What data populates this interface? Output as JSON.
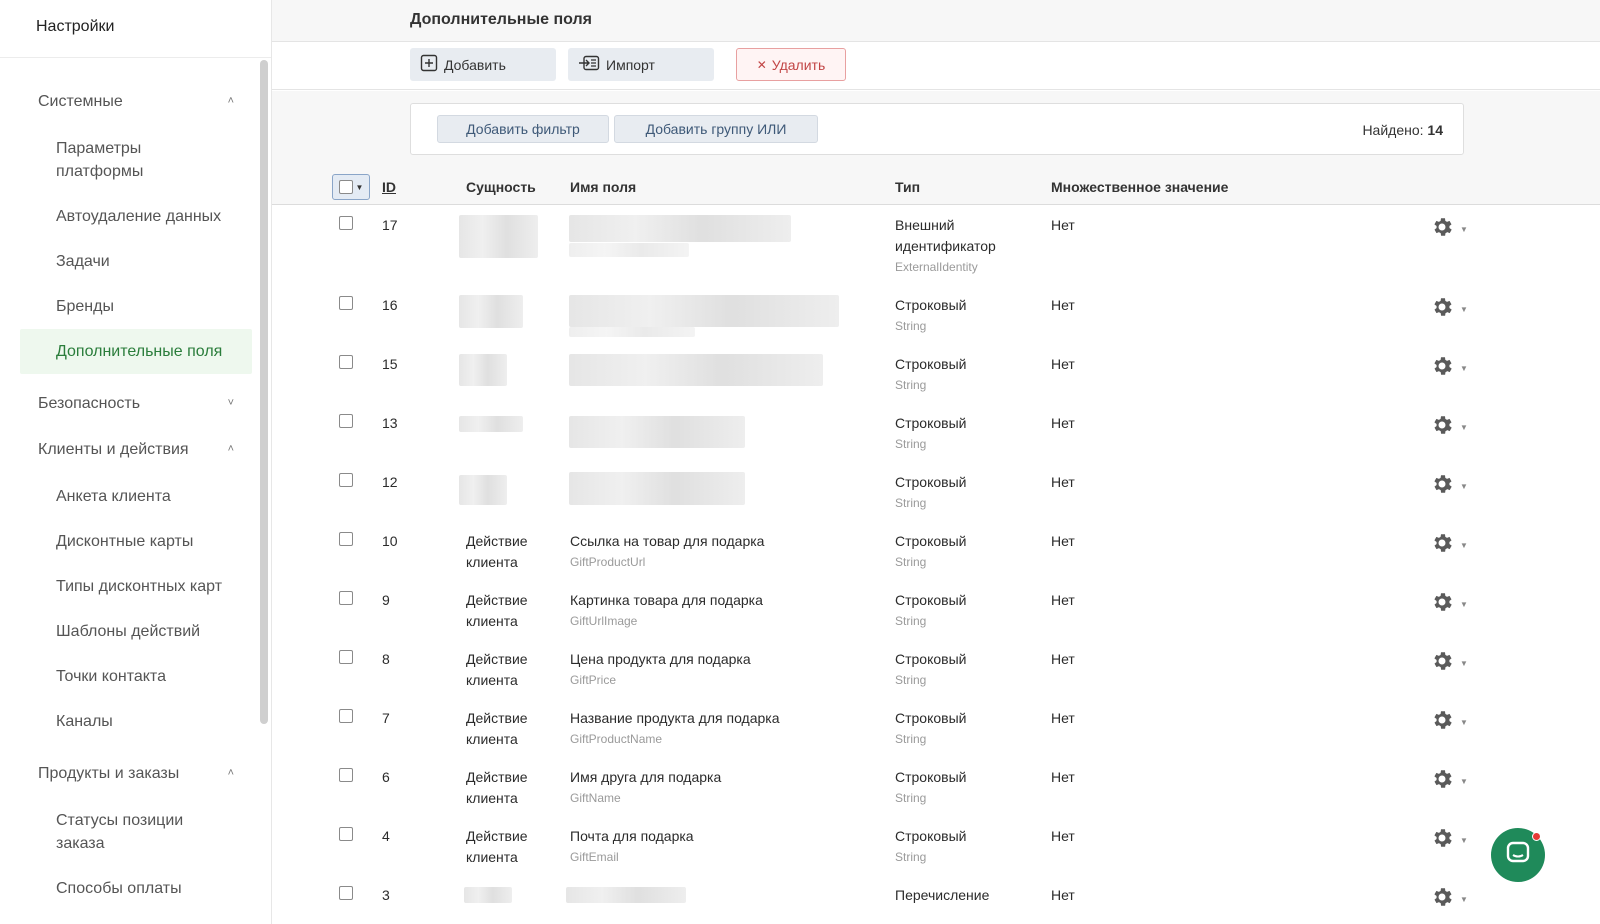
{
  "sidebar": {
    "title": "Настройки",
    "groups": [
      {
        "label": "Системные",
        "expanded": true,
        "items": [
          {
            "label": "Параметры платформы"
          },
          {
            "label": "Автоудаление данных"
          },
          {
            "label": "Задачи"
          },
          {
            "label": "Бренды"
          },
          {
            "label": "Дополнительные поля",
            "active": true
          }
        ]
      },
      {
        "label": "Безопасность",
        "expanded": false,
        "items": []
      },
      {
        "label": "Клиенты и действия",
        "expanded": true,
        "items": [
          {
            "label": "Анкета клиента"
          },
          {
            "label": "Дисконтные карты"
          },
          {
            "label": "Типы дисконтных карт"
          },
          {
            "label": "Шаблоны действий"
          },
          {
            "label": "Точки контакта"
          },
          {
            "label": "Каналы"
          }
        ]
      },
      {
        "label": "Продукты и заказы",
        "expanded": true,
        "items": [
          {
            "label": "Статусы позиции заказа"
          },
          {
            "label": "Способы оплаты"
          }
        ]
      }
    ]
  },
  "header": {
    "title": "Дополнительные поля"
  },
  "toolbar": {
    "add": "Добавить",
    "import": "Импорт",
    "delete": "Удалить"
  },
  "filters": {
    "add_filter": "Добавить фильтр",
    "add_or_group": "Добавить группу ИЛИ",
    "found_label": "Найдено:",
    "found_count": "14"
  },
  "table": {
    "columns": {
      "id": "ID",
      "entity": "Сущность",
      "name": "Имя поля",
      "type": "Тип",
      "multi": "Множественное значение"
    },
    "rows": [
      {
        "id": "17",
        "entity": "",
        "name": "",
        "system": "",
        "type": "Внешний идентификатор",
        "type_sys": "ExternalIdentity",
        "multi": "Нет",
        "redacted": true
      },
      {
        "id": "16",
        "entity": "",
        "name": "",
        "system": "",
        "type": "Строковый",
        "type_sys": "String",
        "multi": "Нет",
        "redacted": true
      },
      {
        "id": "15",
        "entity": "",
        "name": "",
        "system": "",
        "type": "Строковый",
        "type_sys": "String",
        "multi": "Нет",
        "redacted": true
      },
      {
        "id": "13",
        "entity": "",
        "name": "",
        "system": "",
        "type": "Строковый",
        "type_sys": "String",
        "multi": "Нет",
        "redacted": true
      },
      {
        "id": "12",
        "entity": "",
        "name": "",
        "system": "",
        "type": "Строковый",
        "type_sys": "String",
        "multi": "Нет",
        "redacted": true
      },
      {
        "id": "10",
        "entity": "Действие клиента",
        "name": "Ссылка на товар для подарка",
        "system": "GiftProductUrl",
        "type": "Строковый",
        "type_sys": "String",
        "multi": "Нет"
      },
      {
        "id": "9",
        "entity": "Действие клиента",
        "name": "Картинка товара для подарка",
        "system": "GiftUrlImage",
        "type": "Строковый",
        "type_sys": "String",
        "multi": "Нет"
      },
      {
        "id": "8",
        "entity": "Действие клиента",
        "name": "Цена продукта для подарка",
        "system": "GiftPrice",
        "type": "Строковый",
        "type_sys": "String",
        "multi": "Нет"
      },
      {
        "id": "7",
        "entity": "Действие клиента",
        "name": "Название продукта для подарка",
        "system": "GiftProductName",
        "type": "Строковый",
        "type_sys": "String",
        "multi": "Нет"
      },
      {
        "id": "6",
        "entity": "Действие клиента",
        "name": "Имя друга для подарка",
        "system": "GiftName",
        "type": "Строковый",
        "type_sys": "String",
        "multi": "Нет"
      },
      {
        "id": "4",
        "entity": "Действие клиента",
        "name": "Почта для подарка",
        "system": "GiftEmail",
        "type": "Строковый",
        "type_sys": "String",
        "multi": "Нет"
      },
      {
        "id": "3",
        "entity": "",
        "name": "",
        "system": "",
        "type": "Перечисление",
        "type_sys": "",
        "multi": "Нет",
        "redacted": true
      }
    ]
  },
  "icons": {
    "add": "plus-square-icon",
    "import": "import-icon",
    "delete": "close-icon",
    "settings": "gear-icon",
    "chat": "chat-icon"
  },
  "colors": {
    "accent": "#2a7d3b",
    "active_bg": "#eef8ee",
    "delete": "#c24646",
    "chat": "#1f8a5a"
  }
}
